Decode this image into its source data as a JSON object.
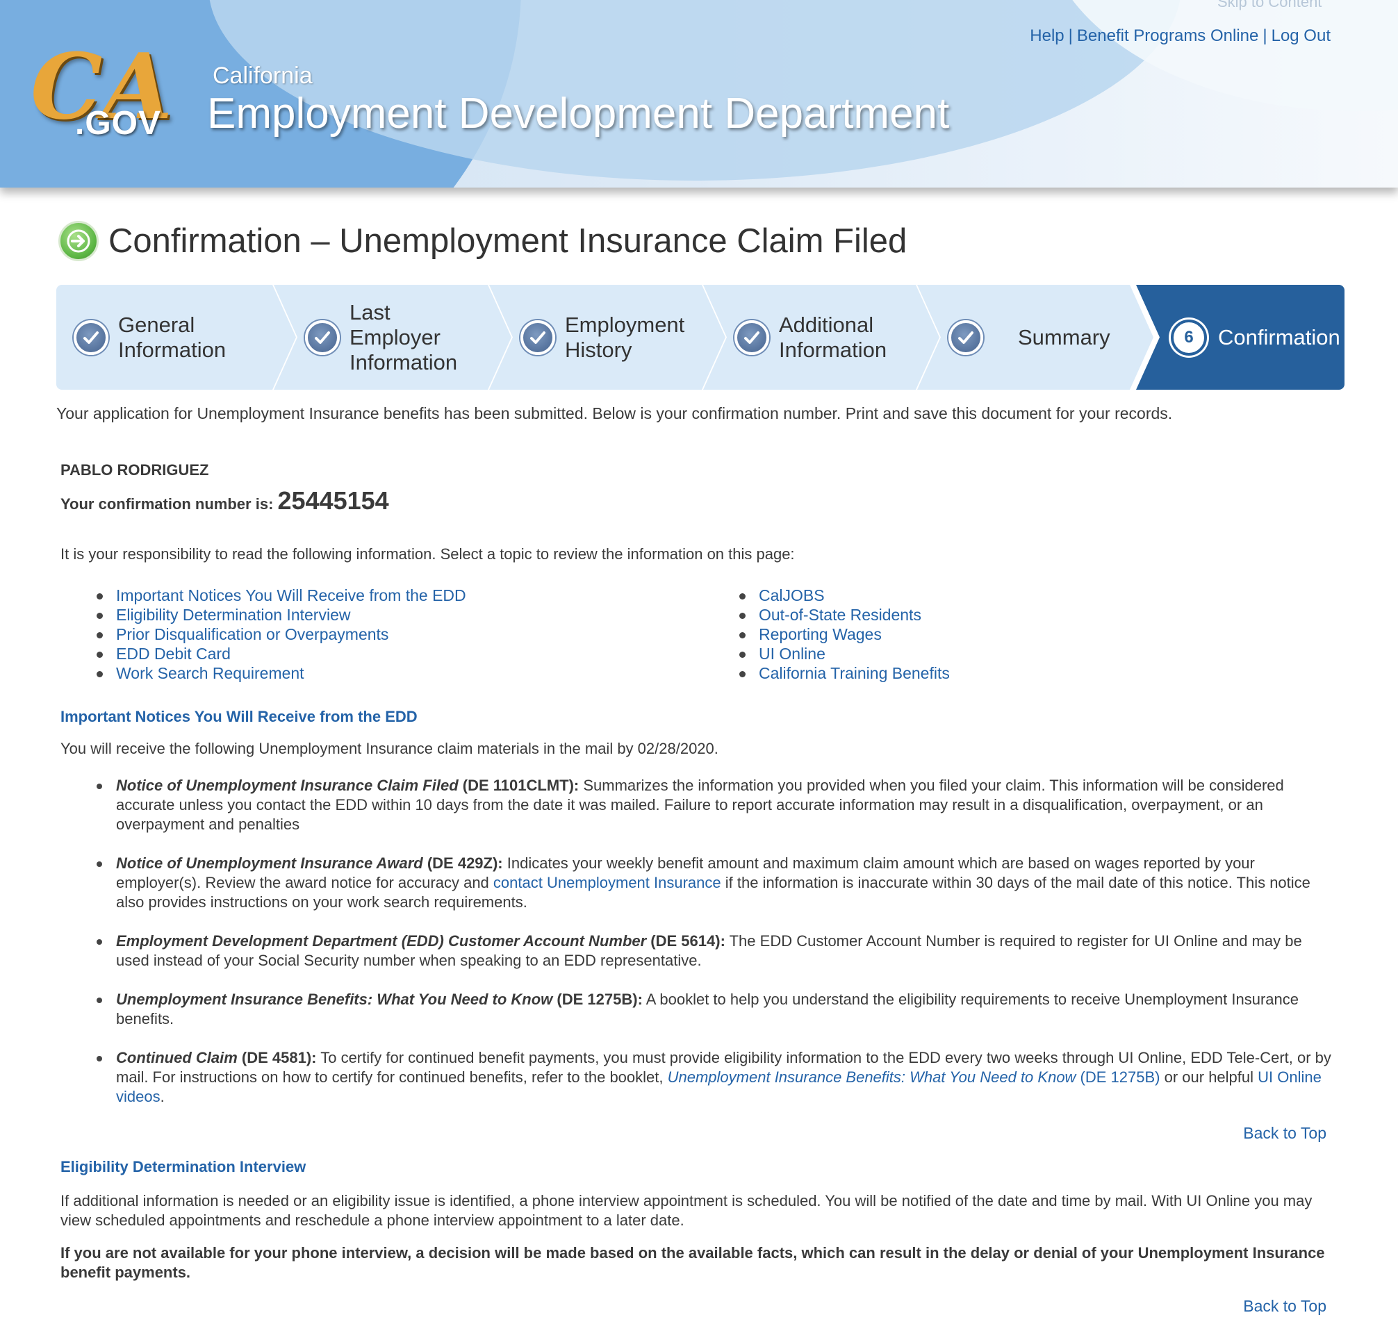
{
  "header": {
    "skip_link": "Skip to Content",
    "util_links": [
      "Help",
      "Benefit Programs Online",
      "Log Out"
    ],
    "logo_ca": "CA",
    "logo_gov": ".GOV",
    "brand_small": "California",
    "brand_big": "Employment Development Department"
  },
  "page_title": "Confirmation – Unemployment Insurance Claim Filed",
  "stepper": {
    "steps": [
      {
        "label": "General Information",
        "status": "complete"
      },
      {
        "label": "Last Employer Information",
        "status": "complete"
      },
      {
        "label": "Employment History",
        "status": "complete"
      },
      {
        "label": "Additional Information",
        "status": "complete"
      },
      {
        "label": "Summary",
        "status": "complete"
      },
      {
        "label": "Confirmation",
        "status": "current",
        "number": "6"
      }
    ]
  },
  "intro": "Your application for Unemployment Insurance benefits has been submitted. Below is your confirmation number. Print and save this document for your records.",
  "claimant_name": "PABLO RODRIGUEZ",
  "confirmation": {
    "label": "Your confirmation number is:",
    "number": "25445154"
  },
  "responsibility_text": "It is your responsibility to read the following information. Select a topic to review the information on this page:",
  "topics_left": [
    "Important Notices You Will Receive from the EDD",
    "Eligibility Determination Interview",
    "Prior Disqualification or Overpayments",
    "EDD Debit Card",
    "Work Search Requirement"
  ],
  "topics_right": [
    "CalJOBS",
    "Out-of-State Residents",
    "Reporting Wages",
    "UI Online",
    "California Training Benefits"
  ],
  "notices_section": {
    "heading": "Important Notices You Will Receive from the EDD",
    "intro": "You will receive the following Unemployment Insurance claim materials in the mail by 02/28/2020.",
    "items": [
      {
        "title": "Notice of Unemployment Insurance Claim Filed",
        "code": " (DE 1101CLMT):",
        "text": " Summarizes the information you provided when you filed your claim. This information will be considered accurate unless you contact the EDD within 10 days from the date it was mailed. Failure to report accurate information may result in a disqualification, overpayment, or an overpayment and penalties"
      },
      {
        "title": "Notice of Unemployment Insurance Award",
        "code": " (DE 429Z):",
        "text_before": " Indicates your weekly benefit amount and maximum claim amount which are based on wages reported by your employer(s). Review the award notice for accuracy and ",
        "link": "contact Unemployment Insurance",
        "text_after": " if the information is inaccurate within 30 days of the mail date of this notice. This notice also provides instructions on your work search requirements."
      },
      {
        "title": "Employment Development Department (EDD) Customer Account Number",
        "code": " (DE 5614):",
        "text": " The EDD Customer Account Number is required to register for UI Online and may be used instead of your Social Security number when speaking to an EDD representative."
      },
      {
        "title": "Unemployment Insurance Benefits: What You Need to Know",
        "code": " (DE 1275B):",
        "text": " A booklet to help you understand the eligibility requirements to receive Unemployment Insurance benefits."
      },
      {
        "title": "Continued Claim",
        "code": " (DE 4581):",
        "text_before": " To certify for continued benefit payments, you must provide eligibility information to the EDD every two weeks through UI Online, EDD Tele-Cert, or by mail. For instructions on how to certify for continued benefits, refer to the booklet, ",
        "link_italic": "Unemployment Insurance Benefits: What You Need to Know",
        "link_plain": " (DE 1275B)",
        "text_mid": " or our helpful ",
        "link2": "UI Online videos",
        "text_after": "."
      }
    ]
  },
  "back_to_top": "Back to Top",
  "interview_section": {
    "heading": "Eligibility Determination Interview",
    "para1": "If additional information is needed or an eligibility issue is identified, a phone interview appointment is scheduled. You will be notified of the date and time by mail. With UI Online you may view scheduled appointments and reschedule a phone interview appointment to a later date.",
    "para2": "If you are not available for your phone interview, a decision will be made based on the available facts, which can result in the delay or denial of your Unemployment Insurance benefit payments."
  },
  "colors": {
    "link": "#2463a8",
    "step_bg": "#daeaf8",
    "step_active": "#26609c",
    "title_icon": "#5cb644"
  }
}
